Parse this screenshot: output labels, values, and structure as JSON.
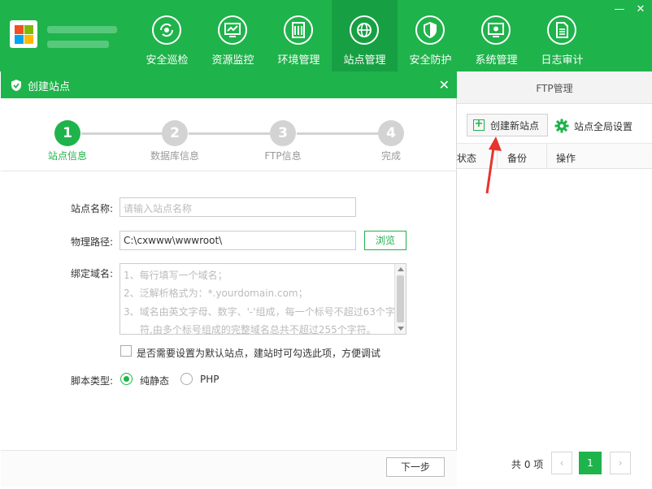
{
  "colors": {
    "brand": "#1fb34b",
    "brand_dark": "#17a043",
    "annotation": "#e8332e"
  },
  "nav": {
    "items": [
      {
        "label": "安全巡检",
        "icon": "refresh-eye-icon"
      },
      {
        "label": "资源监控",
        "icon": "monitor-chart-icon"
      },
      {
        "label": "环境管理",
        "icon": "server-icon"
      },
      {
        "label": "站点管理",
        "icon": "globe-icon",
        "active": true
      },
      {
        "label": "安全防护",
        "icon": "shield-icon"
      },
      {
        "label": "系统管理",
        "icon": "settings-monitor-icon"
      },
      {
        "label": "日志审计",
        "icon": "document-icon"
      }
    ]
  },
  "window": {
    "minimize": "—",
    "close": "✕"
  },
  "background": {
    "tab": "FTP管理",
    "create_btn": "创建新站点",
    "global_settings": "站点全局设置",
    "columns": {
      "status": "状态",
      "backup": "备份",
      "action": "操作"
    },
    "pager": {
      "total": "共 0 项",
      "current": "1",
      "prev": "‹",
      "next": "›"
    }
  },
  "dialog": {
    "title": "创建站点",
    "close": "✕",
    "steps": [
      {
        "num": "1",
        "label": "站点信息",
        "active": true
      },
      {
        "num": "2",
        "label": "数据库信息"
      },
      {
        "num": "3",
        "label": "FTP信息"
      },
      {
        "num": "4",
        "label": "完成"
      }
    ],
    "site_name_label": "站点名称:",
    "site_name_placeholder": "请输入站点名称",
    "path_label": "物理路径:",
    "path_value": "C:\\cxwww\\wwwroot\\",
    "browse": "浏览",
    "domain_label": "绑定域名:",
    "domain_hints": [
      "1、每行填写一个域名；",
      "2、泛解析格式为：*.yourdomain.com；",
      "3、域名由英文字母、数字、'-'组成，每一个标号不超过63个字",
      "符,由多个标号组成的完整域名总共不超过255个字符。"
    ],
    "default_site_text": "是否需要设置为默认站点，建站时可勾选此项，方便调试",
    "script_label": "脚本类型:",
    "script_options": [
      "纯静态",
      "PHP"
    ],
    "next": "下一步"
  }
}
